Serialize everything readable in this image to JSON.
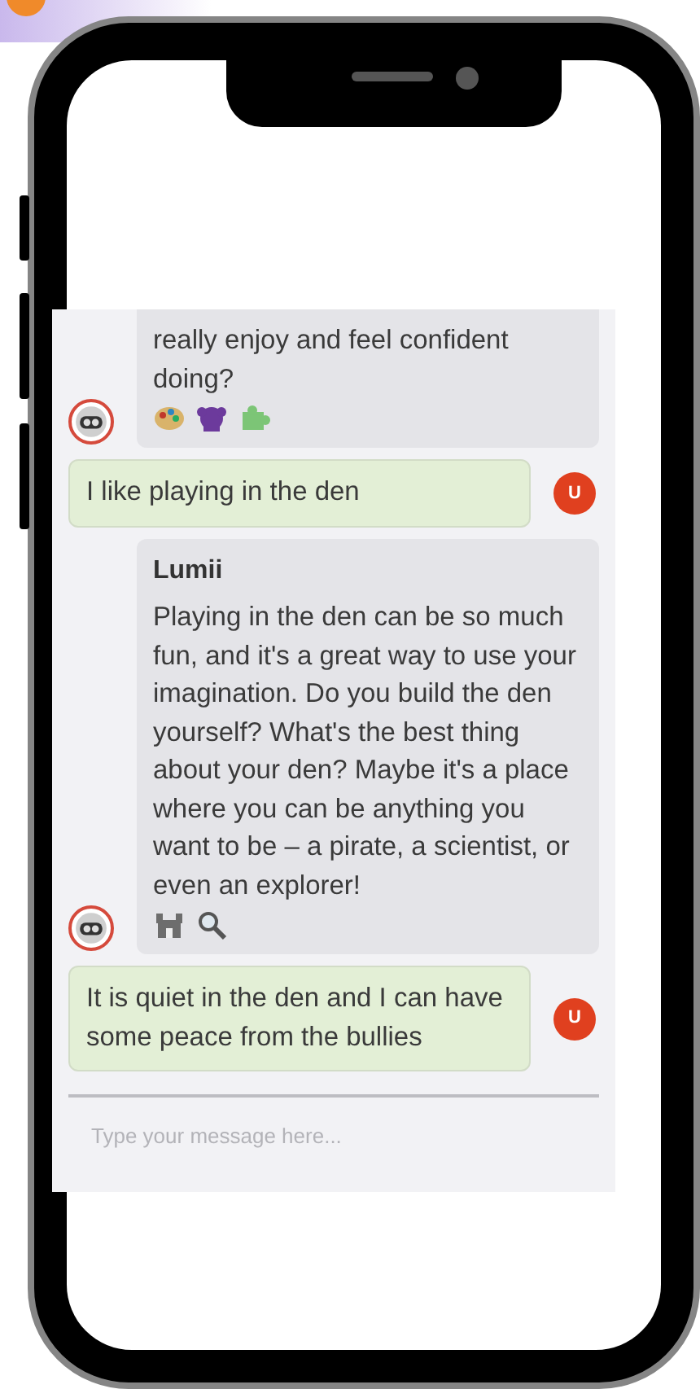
{
  "chat": {
    "messages": [
      {
        "kind": "bot",
        "text": "really enjoy and feel confident doing?",
        "icons": [
          {
            "kind": "palette"
          },
          {
            "kind": "creature"
          },
          {
            "kind": "puzzle"
          }
        ]
      },
      {
        "kind": "user",
        "avatar": "U",
        "text": "I like playing in the den"
      },
      {
        "kind": "bot",
        "name": "Lumii",
        "text": "Playing in the den can be so much fun, and it's a great way to use your imagination. Do you build the den yourself? What's the best thing about your den? Maybe it's a place where you can be anything you want to be – a pirate, a scientist, or even an explorer!",
        "icons": [
          {
            "kind": "castle"
          },
          {
            "kind": "magnifier"
          }
        ]
      },
      {
        "kind": "user",
        "avatar": "U",
        "text": "It is quiet in the den and I can have some peace from the bullies"
      }
    ],
    "input": {
      "placeholder": "Type your message here..."
    }
  }
}
